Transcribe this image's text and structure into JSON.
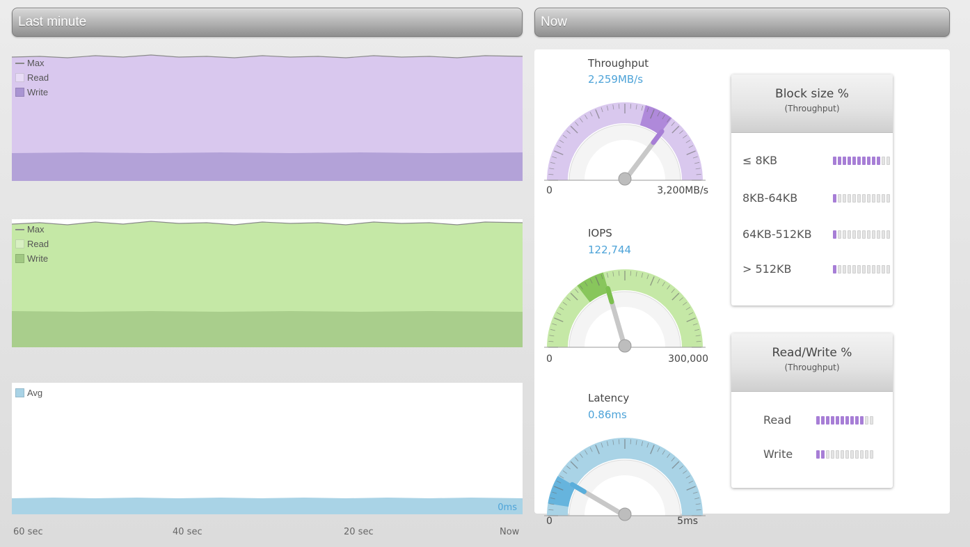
{
  "left_header": {
    "title": "Last minute"
  },
  "right_header": {
    "title": "Now"
  },
  "charts": {
    "throughput_legend": [
      "Max",
      "Read",
      "Write"
    ],
    "iops_legend": [
      "Max",
      "Read",
      "Write"
    ],
    "latency_legend": [
      "Avg"
    ],
    "latency_current": "0ms"
  },
  "time_axis": [
    "60 sec",
    "40 sec",
    "20 sec",
    "Now"
  ],
  "gauges": {
    "throughput": {
      "title": "Throughput",
      "value": "2,259MB/s",
      "min": "0",
      "max": "3,200MB/s",
      "level": 0.706
    },
    "iops": {
      "title": "IOPS",
      "value": "122,744",
      "min": "0",
      "max": "300,000",
      "level": 0.41
    },
    "latency": {
      "title": "Latency",
      "value": "0.86ms",
      "min": "0",
      "max": "5ms",
      "level": 0.17
    }
  },
  "block_size_card": {
    "title": "Block size %",
    "subtitle": "(Throughput)",
    "rows": [
      {
        "label": "≤ 8KB",
        "fill": 0.85
      },
      {
        "label": "8KB-64KB",
        "fill": 0.05
      },
      {
        "label": "64KB-512KB",
        "fill": 0.05
      },
      {
        "label": "> 512KB",
        "fill": 0.0
      }
    ]
  },
  "rw_card": {
    "title": "Read/Write %",
    "subtitle": "(Throughput)",
    "rows": [
      {
        "label": "Read",
        "fill": 0.82
      },
      {
        "label": "Write",
        "fill": 0.18
      }
    ]
  },
  "colors": {
    "throughput_light": "#d9c8ee",
    "throughput_dark": "#b3a2d8",
    "throughput_accent": "#a77ed6",
    "iops_light": "#c5e8a6",
    "iops_dark": "#a9ce8c",
    "iops_accent": "#7cc04f",
    "latency_fill": "#a9d3e6",
    "latency_accent": "#5aaedb",
    "value_blue": "#4da3d8"
  },
  "icons": [
    "gauge-needle-icon",
    "segmented-bar-icon"
  ]
}
